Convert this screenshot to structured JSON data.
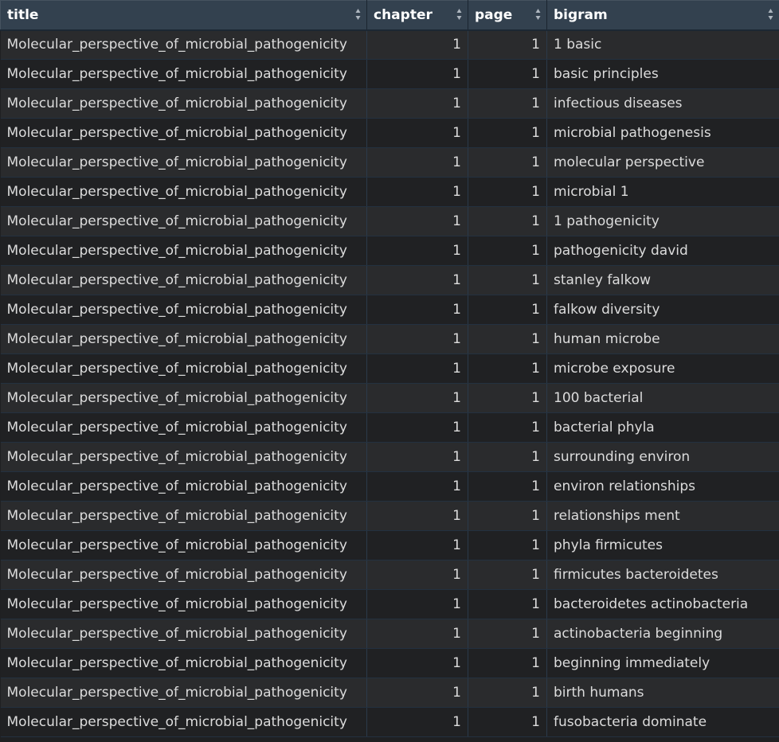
{
  "table": {
    "columns": [
      {
        "key": "title",
        "label": "title"
      },
      {
        "key": "chapter",
        "label": "chapter"
      },
      {
        "key": "page",
        "label": "page"
      },
      {
        "key": "bigram",
        "label": "bigram"
      }
    ],
    "rows": [
      {
        "title": "Molecular_perspective_of_microbial_pathogenicity",
        "chapter": "1",
        "page": "1",
        "bigram": "1 basic"
      },
      {
        "title": "Molecular_perspective_of_microbial_pathogenicity",
        "chapter": "1",
        "page": "1",
        "bigram": "basic principles"
      },
      {
        "title": "Molecular_perspective_of_microbial_pathogenicity",
        "chapter": "1",
        "page": "1",
        "bigram": "infectious diseases"
      },
      {
        "title": "Molecular_perspective_of_microbial_pathogenicity",
        "chapter": "1",
        "page": "1",
        "bigram": "microbial pathogenesis"
      },
      {
        "title": "Molecular_perspective_of_microbial_pathogenicity",
        "chapter": "1",
        "page": "1",
        "bigram": "molecular perspective"
      },
      {
        "title": "Molecular_perspective_of_microbial_pathogenicity",
        "chapter": "1",
        "page": "1",
        "bigram": "microbial 1"
      },
      {
        "title": "Molecular_perspective_of_microbial_pathogenicity",
        "chapter": "1",
        "page": "1",
        "bigram": "1 pathogenicity"
      },
      {
        "title": "Molecular_perspective_of_microbial_pathogenicity",
        "chapter": "1",
        "page": "1",
        "bigram": "pathogenicity david"
      },
      {
        "title": "Molecular_perspective_of_microbial_pathogenicity",
        "chapter": "1",
        "page": "1",
        "bigram": "stanley falkow"
      },
      {
        "title": "Molecular_perspective_of_microbial_pathogenicity",
        "chapter": "1",
        "page": "1",
        "bigram": "falkow diversity"
      },
      {
        "title": "Molecular_perspective_of_microbial_pathogenicity",
        "chapter": "1",
        "page": "1",
        "bigram": "human microbe"
      },
      {
        "title": "Molecular_perspective_of_microbial_pathogenicity",
        "chapter": "1",
        "page": "1",
        "bigram": "microbe exposure"
      },
      {
        "title": "Molecular_perspective_of_microbial_pathogenicity",
        "chapter": "1",
        "page": "1",
        "bigram": "100 bacterial"
      },
      {
        "title": "Molecular_perspective_of_microbial_pathogenicity",
        "chapter": "1",
        "page": "1",
        "bigram": "bacterial phyla"
      },
      {
        "title": "Molecular_perspective_of_microbial_pathogenicity",
        "chapter": "1",
        "page": "1",
        "bigram": "surrounding environ"
      },
      {
        "title": "Molecular_perspective_of_microbial_pathogenicity",
        "chapter": "1",
        "page": "1",
        "bigram": "environ relationships"
      },
      {
        "title": "Molecular_perspective_of_microbial_pathogenicity",
        "chapter": "1",
        "page": "1",
        "bigram": "relationships ment"
      },
      {
        "title": "Molecular_perspective_of_microbial_pathogenicity",
        "chapter": "1",
        "page": "1",
        "bigram": "phyla firmicutes"
      },
      {
        "title": "Molecular_perspective_of_microbial_pathogenicity",
        "chapter": "1",
        "page": "1",
        "bigram": "firmicutes bacteroidetes"
      },
      {
        "title": "Molecular_perspective_of_microbial_pathogenicity",
        "chapter": "1",
        "page": "1",
        "bigram": "bacteroidetes actinobacteria"
      },
      {
        "title": "Molecular_perspective_of_microbial_pathogenicity",
        "chapter": "1",
        "page": "1",
        "bigram": "actinobacteria beginning"
      },
      {
        "title": "Molecular_perspective_of_microbial_pathogenicity",
        "chapter": "1",
        "page": "1",
        "bigram": "beginning immediately"
      },
      {
        "title": "Molecular_perspective_of_microbial_pathogenicity",
        "chapter": "1",
        "page": "1",
        "bigram": "birth humans"
      },
      {
        "title": "Molecular_perspective_of_microbial_pathogenicity",
        "chapter": "1",
        "page": "1",
        "bigram": "fusobacteria dominate"
      }
    ]
  },
  "icons": {
    "sort": "sort-icon"
  },
  "colors": {
    "header_bg": "#33414f",
    "row_odd": "#2a2b2d",
    "row_even": "#202123",
    "text": "#dcdcdc"
  }
}
